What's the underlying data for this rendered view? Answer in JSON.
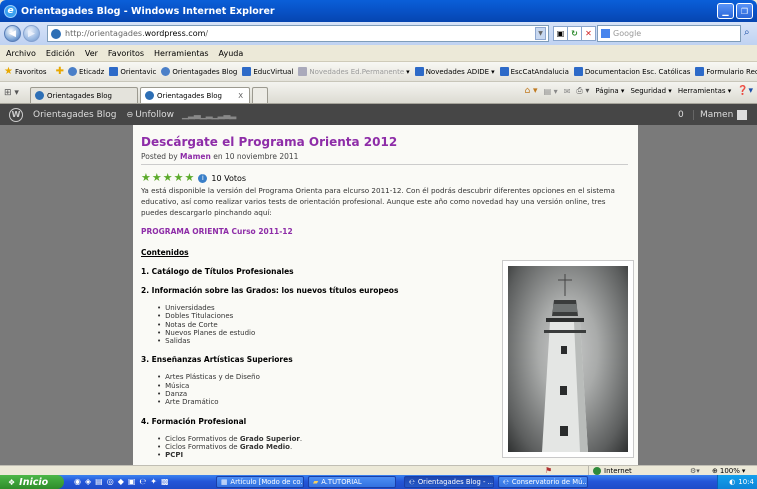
{
  "window": {
    "title": "Orientagades Blog - Windows Internet Explorer"
  },
  "address": {
    "url_prefix": "http://orientagades.",
    "url_domain": "wordpress.com",
    "url_suffix": "/",
    "search_placeholder": "Google"
  },
  "menu": [
    "Archivo",
    "Edición",
    "Ver",
    "Favoritos",
    "Herramientas",
    "Ayuda"
  ],
  "favorites": {
    "label": "Favoritos",
    "items": [
      {
        "label": "Eticadz",
        "disabled": false
      },
      {
        "label": "Orientavic",
        "disabled": false
      },
      {
        "label": "Orientagades Blog",
        "disabled": false
      },
      {
        "label": "EducVirtual",
        "disabled": false
      },
      {
        "label": "Novedades Ed.Permanente",
        "disabled": true
      },
      {
        "label": "Novedades ADIDE",
        "disabled": false
      },
      {
        "label": "EscCatAndalucia",
        "disabled": false
      },
      {
        "label": "Documentacion Esc. Católicas",
        "disabled": false
      },
      {
        "label": "Formulario Recursos",
        "disabled": false
      }
    ]
  },
  "tabs": {
    "items": [
      "Orientagades Blog",
      "Orientagades Blog"
    ],
    "close": "X"
  },
  "commands": [
    "Página",
    "Seguridad",
    "Herramientas"
  ],
  "wpbar": {
    "blog_name": "Orientagades Blog",
    "unfollow": "Unfollow",
    "notifications": "0",
    "user": "Mamen"
  },
  "post": {
    "title": "Descárgate el Programa Orienta 2012",
    "posted_by": "Posted by",
    "author": "Mamen",
    "date": "en 10 noviembre 2011",
    "votes": "10 Votos",
    "intro": "Ya está disponible la versión del Programa Orienta para elcurso 2011-12. Con él podrás descubrir diferentes opciones en el sistema educativo, así como realizar varios tests de orientación profesional. Aunque este año como novedad hay una versión online, tres puedes descargarlo pinchando aquí:",
    "link": "PROGRAMA ORIENTA Curso 2011-12",
    "contents_heading": "Contenidos",
    "sections": [
      {
        "title": "1. Catálogo de Títulos Profesionales",
        "items": []
      },
      {
        "title": "2. Información sobre las Grados: los nuevos títulos europeos",
        "items": [
          "Universidades",
          "Dobles Titulaciones",
          "Notas de Corte",
          "Nuevos Planes de estudio",
          "Salidas"
        ]
      },
      {
        "title": "3. Enseñanzas Artísticas Superiores",
        "items": [
          "Artes Plásticas y de Diseño",
          "Música",
          "Danza",
          "Arte Dramático"
        ]
      },
      {
        "title": "4. Formación Profesional",
        "items": []
      }
    ],
    "fp_items": [
      {
        "text": "Ciclos Formativos de ",
        "bold": "Grado Superior",
        "end": "."
      },
      {
        "text": "Ciclos Formativos de ",
        "bold": "Grado Medio",
        "end": "."
      },
      {
        "text": "",
        "bold": "PCPI",
        "end": ""
      }
    ]
  },
  "status": {
    "zone": "Internet",
    "zoom": "100%"
  },
  "taskbar": {
    "start": "Inicio",
    "tasks": [
      "Artículo [Modo de co...",
      "A.TUTORIAL",
      "Orientagades Blog - ...",
      "Conservatorio de Mú..."
    ],
    "clock": "10:4"
  },
  "colors": {
    "accent": "#8E2DA8",
    "titlebar": "#0853C8",
    "wpbar": "#464646"
  }
}
